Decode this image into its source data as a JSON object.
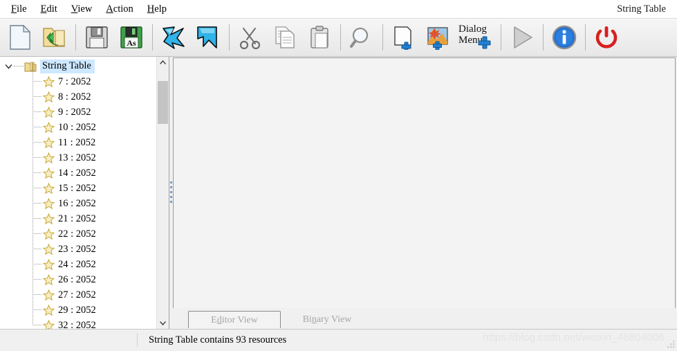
{
  "window": {
    "title": "String Table"
  },
  "menubar": {
    "items": [
      {
        "label": "File",
        "mnemonic": "F"
      },
      {
        "label": "Edit",
        "mnemonic": "E"
      },
      {
        "label": "View",
        "mnemonic": "V"
      },
      {
        "label": "Action",
        "mnemonic": "A"
      },
      {
        "label": "Help",
        "mnemonic": "H"
      }
    ]
  },
  "toolbar": {
    "buttons": [
      {
        "name": "new-file-icon",
        "tooltip": "New"
      },
      {
        "name": "open-folder-icon",
        "tooltip": "Open"
      },
      {
        "name": "save-icon",
        "tooltip": "Save"
      },
      {
        "name": "save-as-icon",
        "tooltip": "Save As",
        "badge": "As"
      },
      {
        "name": "undo-arrow-icon",
        "tooltip": "Undo"
      },
      {
        "name": "redo-arrow-icon",
        "tooltip": "Redo"
      },
      {
        "name": "cut-scissors-icon",
        "tooltip": "Cut"
      },
      {
        "name": "copy-icon",
        "tooltip": "Copy"
      },
      {
        "name": "paste-clipboard-icon",
        "tooltip": "Paste"
      },
      {
        "name": "search-magnifier-icon",
        "tooltip": "Search"
      },
      {
        "name": "add-page-icon",
        "tooltip": "Add Resource"
      },
      {
        "name": "add-image-icon",
        "tooltip": "Add Image"
      },
      {
        "name": "add-dialog-menu-icon",
        "tooltip": "Add Dialog Menu",
        "label_line1": "Dialog",
        "label_line2": "Menu"
      },
      {
        "name": "run-play-icon",
        "tooltip": "Run"
      },
      {
        "name": "info-icon",
        "tooltip": "About"
      },
      {
        "name": "power-exit-icon",
        "tooltip": "Exit"
      }
    ]
  },
  "tree": {
    "root": {
      "label": "String Table",
      "expanded": true,
      "selected": true
    },
    "items": [
      {
        "label": "7 : 2052"
      },
      {
        "label": "8 : 2052"
      },
      {
        "label": "9 : 2052"
      },
      {
        "label": "10 : 2052"
      },
      {
        "label": "11 : 2052"
      },
      {
        "label": "13 : 2052"
      },
      {
        "label": "14 : 2052"
      },
      {
        "label": "15 : 2052"
      },
      {
        "label": "16 : 2052"
      },
      {
        "label": "21 : 2052"
      },
      {
        "label": "22 : 2052"
      },
      {
        "label": "23 : 2052"
      },
      {
        "label": "24 : 2052"
      },
      {
        "label": "26 : 2052"
      },
      {
        "label": "27 : 2052"
      },
      {
        "label": "29 : 2052"
      },
      {
        "label": "32 : 2052"
      }
    ]
  },
  "tabs": [
    {
      "label": "Editor View",
      "pre": "E",
      "mn": "d",
      "post": "itor View",
      "active": true
    },
    {
      "label": "Binary View",
      "pre": "Bi",
      "mn": "n",
      "post": "ary View",
      "active": false
    }
  ],
  "statusbar": {
    "left": "",
    "message": "String Table contains 93 resources"
  },
  "watermark": "https://blog.csdn.net/weixin_46804006",
  "colors": {
    "selection": "#cde8ff",
    "star": "#f4e3a1",
    "accent_blue": "#29a3e0",
    "power_red": "#d81f1f",
    "plus_blue": "#1f7fd4"
  }
}
